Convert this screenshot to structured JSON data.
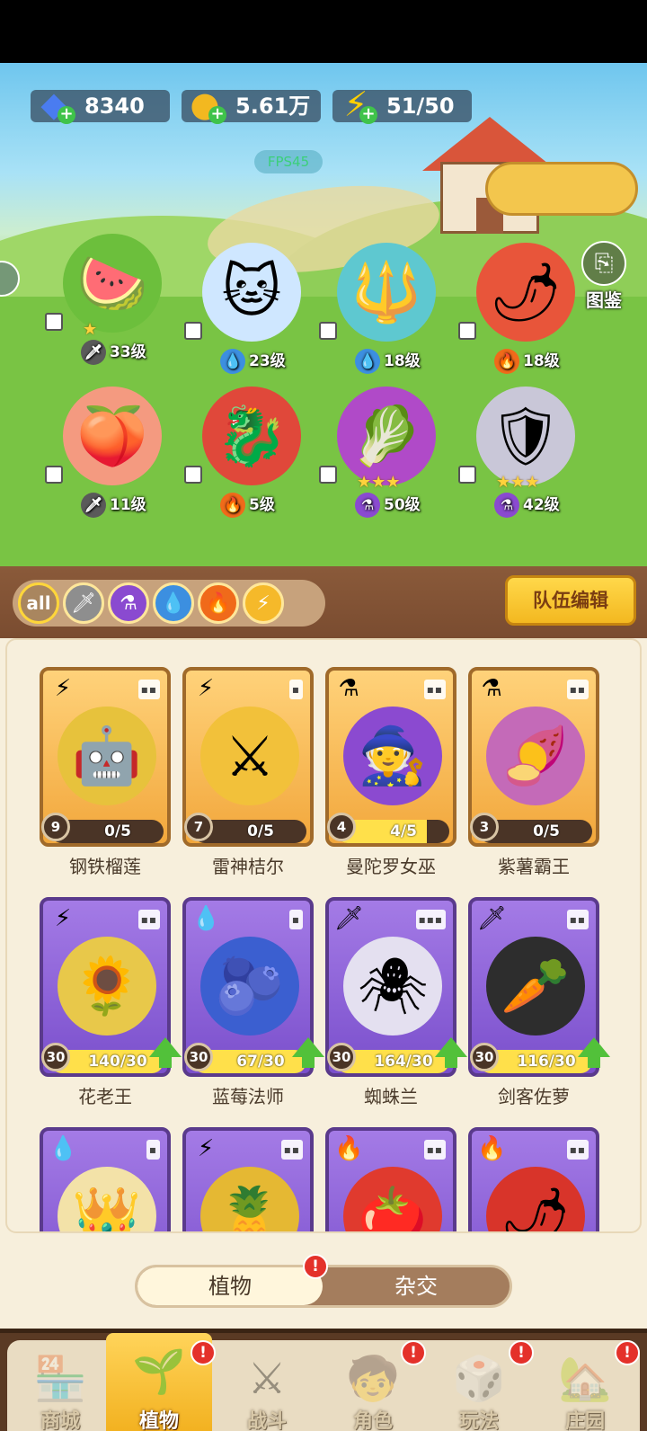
{
  "resources": {
    "gems": "8340",
    "coins": "5.61万",
    "energy": "51/50"
  },
  "fps": "FPS45",
  "codex_label": "图鉴",
  "team_heroes": [
    {
      "level": "33级",
      "element": "sword-icon"
    },
    {
      "level": "23级",
      "element": "water-icon"
    },
    {
      "level": "18级",
      "element": "water-icon"
    },
    {
      "level": "18级",
      "element": "fire-icon"
    },
    {
      "level": "11级",
      "element": "sword-icon"
    },
    {
      "level": "5级",
      "element": "fire-icon"
    },
    {
      "level": "50级",
      "element": "potion-icon"
    },
    {
      "level": "42级",
      "element": "potion-icon"
    }
  ],
  "filters": {
    "all": "all",
    "team_edit": "队伍编辑"
  },
  "cards": [
    {
      "name": "钢铁榴莲",
      "badge": "9",
      "count": "0/5",
      "progress": 0.0
    },
    {
      "name": "雷神桔尔",
      "badge": "7",
      "count": "0/5",
      "progress": 0.0
    },
    {
      "name": "曼陀罗女巫",
      "badge": "4",
      "count": "4/5",
      "progress": 0.8
    },
    {
      "name": "紫薯霸王",
      "badge": "3",
      "count": "0/5",
      "progress": 0.0
    },
    {
      "name": "花老王",
      "badge": "30",
      "count": "140/30",
      "progress": 1.0
    },
    {
      "name": "蓝莓法师",
      "badge": "30",
      "count": "67/30",
      "progress": 1.0
    },
    {
      "name": "蜘蛛兰",
      "badge": "30",
      "count": "164/30",
      "progress": 1.0
    },
    {
      "name": "剑客佐萝",
      "badge": "30",
      "count": "116/30",
      "progress": 1.0
    }
  ],
  "switcher": {
    "plants": "植物",
    "hybrid": "杂交"
  },
  "alert_mark": "!",
  "nav": [
    "商城",
    "植物",
    "战斗",
    "角色",
    "玩法",
    "庄园"
  ]
}
